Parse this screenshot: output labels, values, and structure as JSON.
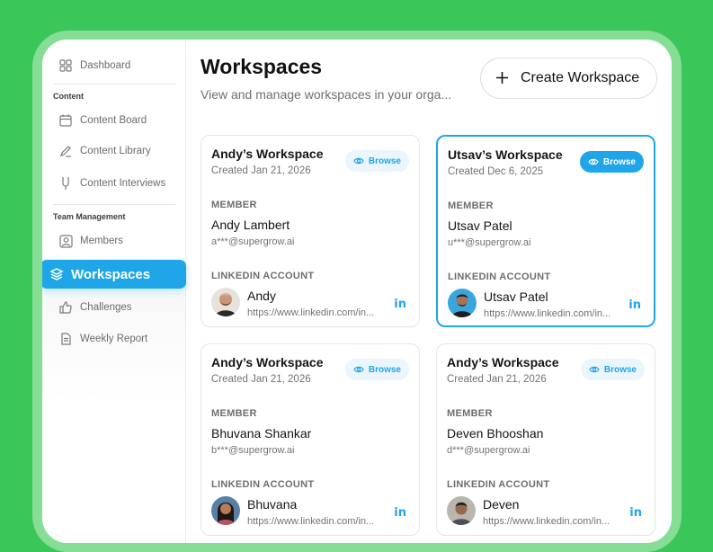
{
  "sidebar": {
    "dashboard": "Dashboard",
    "content_section": "Content",
    "content_board": "Content Board",
    "content_library": "Content Library",
    "content_interviews": "Content Interviews",
    "team_section": "Team Management",
    "members": "Members",
    "workspaces": "Workspaces",
    "challenges": "Challenges",
    "weekly_report": "Weekly Report"
  },
  "header": {
    "title": "Workspaces",
    "subtitle": "View and manage workspaces in your orga...",
    "create_label": "Create Workspace"
  },
  "labels": {
    "member": "MEMBER",
    "linkedin": "LINKEDIN ACCOUNT",
    "browse": "Browse"
  },
  "cards": [
    {
      "name": "Andy’s Workspace",
      "created": "Created Jan 21, 2026",
      "member_name": "Andy Lambert",
      "member_email": "a***@supergrow.ai",
      "li_name": "Andy",
      "li_url": "https://www.linkedin.com/in...",
      "selected": false
    },
    {
      "name": "Utsav’s Workspace",
      "created": "Created Dec 6, 2025",
      "member_name": "Utsav Patel",
      "member_email": "u***@supergrow.ai",
      "li_name": "Utsav Patel",
      "li_url": "https://www.linkedin.com/in...",
      "selected": true
    },
    {
      "name": "Andy’s Workspace",
      "created": "Created Jan 21, 2026",
      "member_name": "Bhuvana Shankar",
      "member_email": "b***@supergrow.ai",
      "li_name": "Bhuvana",
      "li_url": "https://www.linkedin.com/in...",
      "selected": false
    },
    {
      "name": "Andy’s Workspace",
      "created": "Created Jan 21, 2026",
      "member_name": "Deven Bhooshan",
      "member_email": "d***@supergrow.ai",
      "li_name": "Deven",
      "li_url": "https://www.linkedin.com/in...",
      "selected": false
    }
  ],
  "colors": {
    "accent": "#1fa6e8",
    "background": "#3bc65a"
  },
  "icons": {
    "linkedin": "in"
  }
}
